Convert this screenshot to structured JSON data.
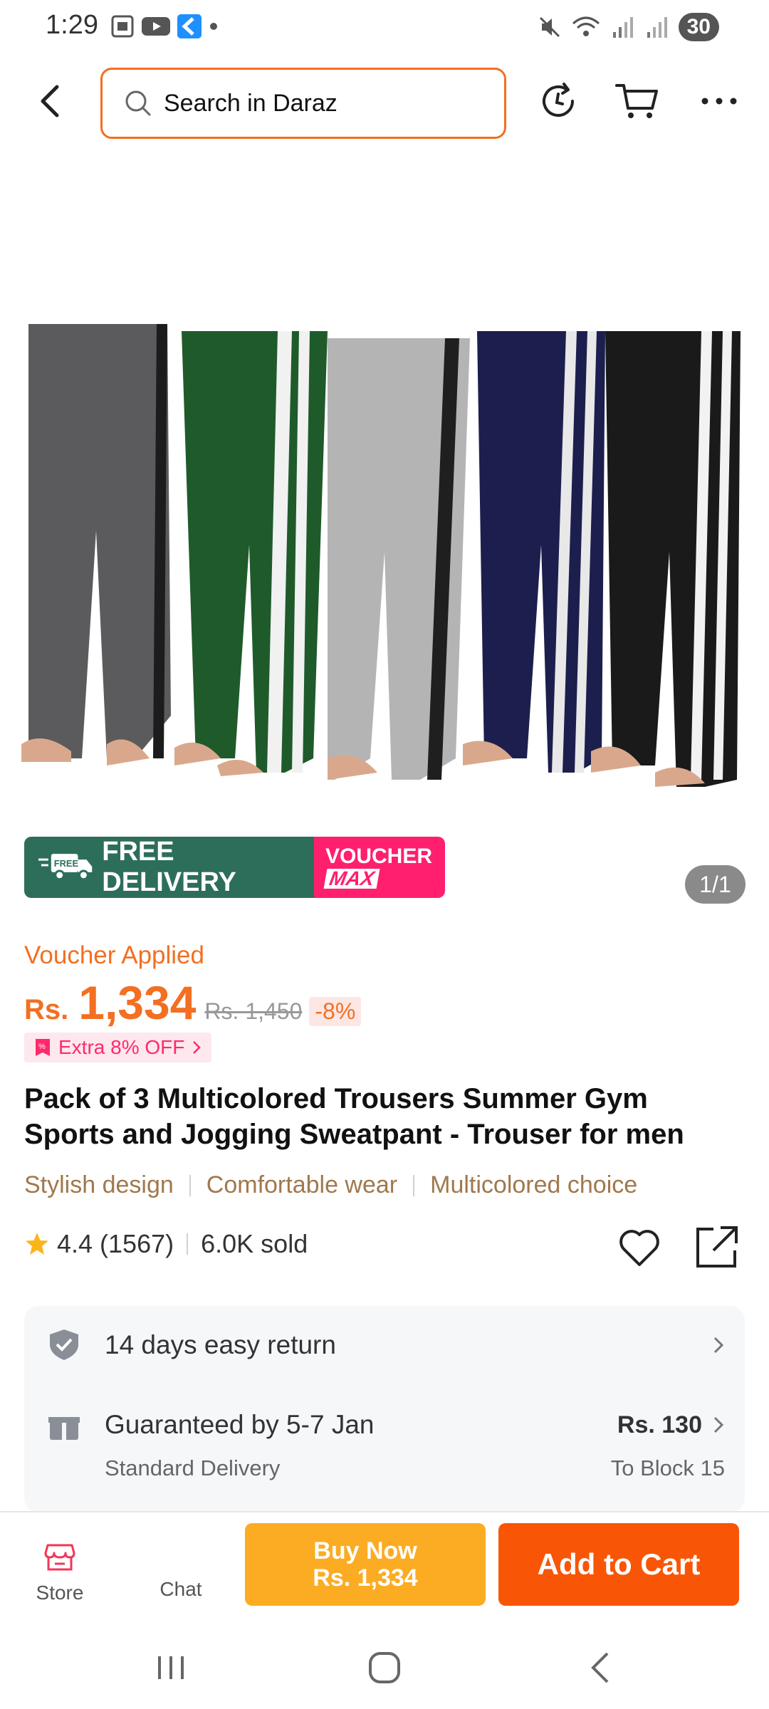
{
  "status_bar": {
    "time": "1:29",
    "battery": "30"
  },
  "header": {
    "search_placeholder": "Search in Daraz"
  },
  "gallery": {
    "page_indicator": "1/1"
  },
  "banner": {
    "free_badge": "FREE",
    "free_delivery": "FREE DELIVERY",
    "voucher_line1": "VOUCHER",
    "voucher_line2": "MAX"
  },
  "price": {
    "voucher_applied": "Voucher Applied",
    "currency": "Rs.",
    "current": "1,334",
    "original": "Rs. 1,450",
    "discount": "-8%",
    "extra_off": "Extra 8% OFF"
  },
  "product": {
    "title": "Pack of 3 Multicolored Trousers Summer Gym Sports and Jogging Sweatpant - Trouser for men",
    "tags": [
      "Stylish design",
      "Comfortable wear",
      "Multicolored choice"
    ],
    "rating": "4.4",
    "reviews": "(1567)",
    "sold": "6.0K sold"
  },
  "services": {
    "return_text": "14 days easy return",
    "delivery_title": "Guaranteed by 5-7 Jan",
    "delivery_sub": "Standard Delivery",
    "delivery_price": "Rs. 130",
    "delivery_to": "To Block 15"
  },
  "bottom_bar": {
    "store_label": "Store",
    "chat_label": "Chat",
    "buy_now_line1": "Buy Now",
    "buy_now_line2": "Rs. 1,334",
    "add_to_cart": "Add to Cart"
  },
  "colors": {
    "accent": "#f85606",
    "buy_now": "#fbac23",
    "free_delivery": "#2d6e5a",
    "voucher": "#ff1f6e"
  }
}
